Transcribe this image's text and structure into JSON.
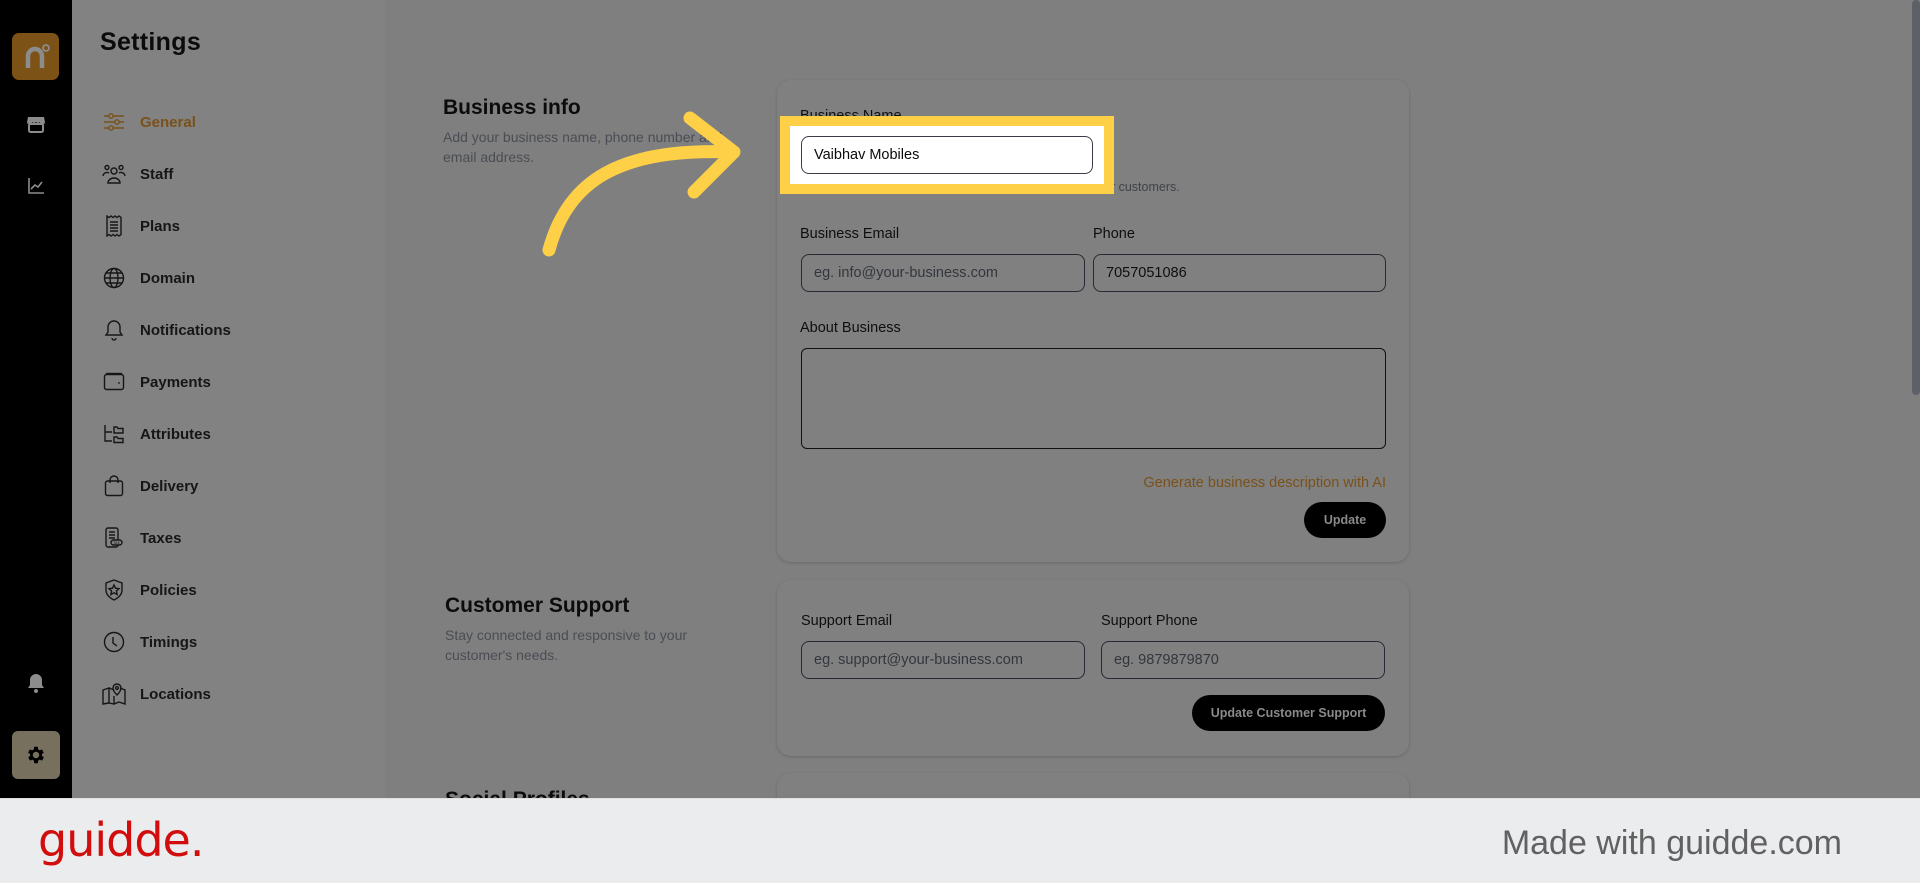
{
  "rail": {
    "logo_letter": "n°",
    "icons": [
      "store-icon",
      "analytics-chart-icon",
      "bell-icon",
      "gear-icon"
    ]
  },
  "nav": {
    "title": "Settings",
    "items": [
      {
        "label": "General",
        "icon": "sliders-icon",
        "active": true
      },
      {
        "label": "Staff",
        "icon": "users-icon",
        "active": false
      },
      {
        "label": "Plans",
        "icon": "receipt-icon",
        "active": false
      },
      {
        "label": "Domain",
        "icon": "globe-icon",
        "active": false
      },
      {
        "label": "Notifications",
        "icon": "bell-icon",
        "active": false
      },
      {
        "label": "Payments",
        "icon": "wallet-icon",
        "active": false
      },
      {
        "label": "Attributes",
        "icon": "hierarchy-icon",
        "active": false
      },
      {
        "label": "Delivery",
        "icon": "shopping-bag-icon",
        "active": false
      },
      {
        "label": "Taxes",
        "icon": "tax-document-icon",
        "active": false
      },
      {
        "label": "Policies",
        "icon": "shield-star-icon",
        "active": false
      },
      {
        "label": "Timings",
        "icon": "clock-icon",
        "active": false
      },
      {
        "label": "Locations",
        "icon": "map-pin-icon",
        "active": false
      }
    ]
  },
  "business_info": {
    "title": "Business info",
    "description": "Add your business name, phone number and email address.",
    "name_label": "Business Name",
    "name_value": "Vaibhav Mobiles",
    "name_helper": "...our customers.",
    "email_label": "Business Email",
    "email_placeholder": "eg. info@your-business.com",
    "email_value": "",
    "phone_label": "Phone",
    "phone_value": "7057051086",
    "about_label": "About Business",
    "about_value": "",
    "ai_link": "Generate business description with AI",
    "update_button": "Update"
  },
  "customer_support": {
    "title": "Customer Support",
    "description": "Stay connected and responsive to your customer's needs.",
    "email_label": "Support Email",
    "email_placeholder": "eg. support@your-business.com",
    "phone_label": "Support Phone",
    "phone_placeholder": "eg. 9879879870",
    "update_button": "Update Customer Support"
  },
  "social_profiles": {
    "title": "Social Profiles"
  },
  "footer": {
    "brand": "guidde.",
    "made_with": "Made with guidde.com"
  },
  "colors": {
    "accent": "#7a5119",
    "highlight": "#fdd047",
    "brand_red": "#d20d0d"
  }
}
